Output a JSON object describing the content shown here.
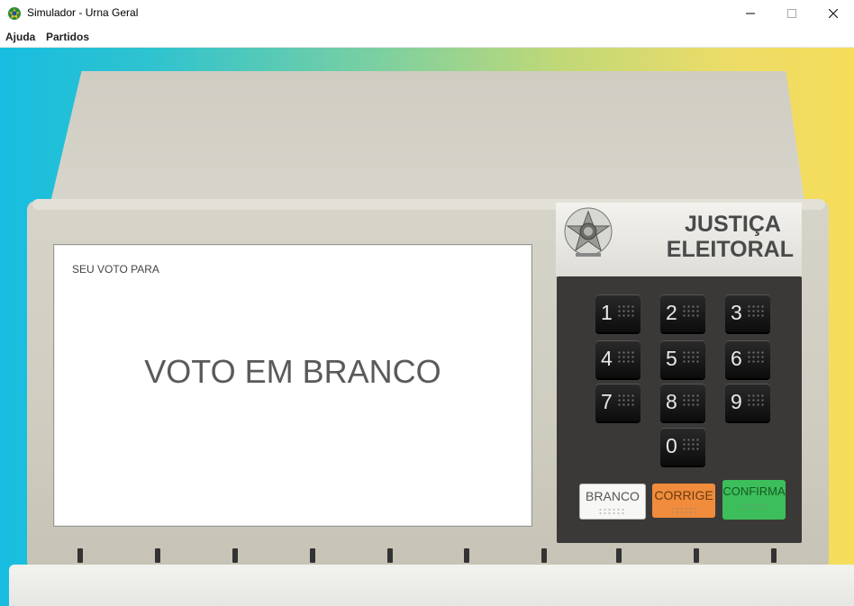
{
  "window": {
    "title": "Simulador - Urna Geral"
  },
  "menu": {
    "items": [
      "Ajuda",
      "Partidos"
    ]
  },
  "screen": {
    "header": "SEU VOTO PARA",
    "message": "VOTO EM BRANCO"
  },
  "panel": {
    "line1": "JUSTIÇA",
    "line2": "ELEITORAL"
  },
  "keypad": {
    "keys": [
      "1",
      "2",
      "3",
      "4",
      "5",
      "6",
      "7",
      "8",
      "9",
      "0"
    ]
  },
  "buttons": {
    "branco": "BRANCO",
    "corrige": "CORRIGE",
    "confirma": "CONFIRMA"
  },
  "icons": {
    "app": "brazil-coat-of-arms-icon",
    "emblem": "brazil-coat-of-arms-icon"
  },
  "colors": {
    "branco": "#f7f7f5",
    "corrige": "#f08c3c",
    "confirma": "#3cbe5a",
    "keypad": "#3b3937"
  }
}
